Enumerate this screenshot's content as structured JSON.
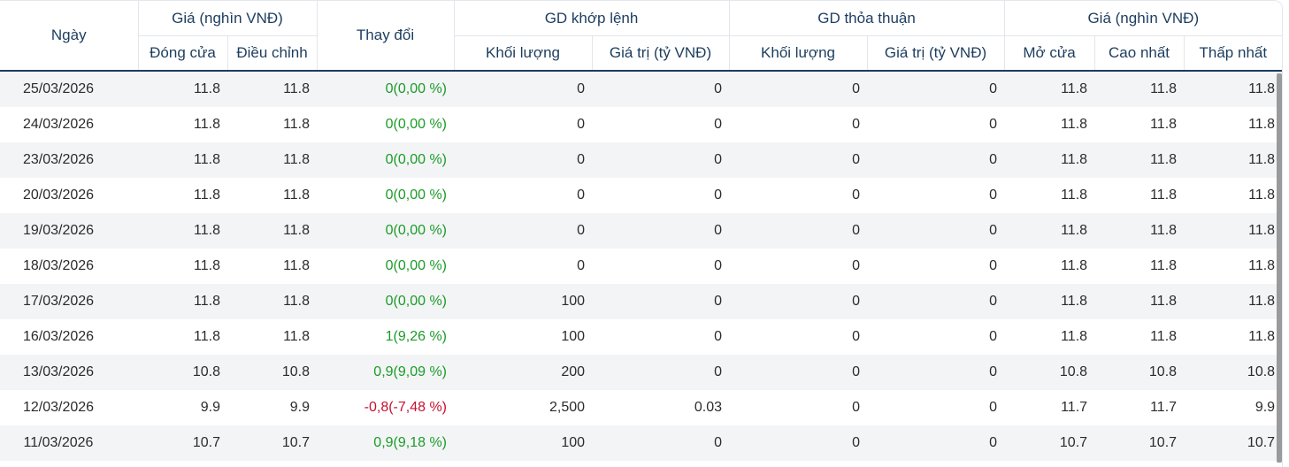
{
  "header": {
    "date": "Ngày",
    "price_group": "Giá (nghìn VNĐ)",
    "change": "Thay đổi",
    "matched_group": "GD khớp lệnh",
    "negotiated_group": "GD thỏa thuận",
    "price_group2": "Giá (nghìn VNĐ)",
    "close": "Đóng cửa",
    "adjusted": "Điều chỉnh",
    "matched_volume": "Khối lượng",
    "matched_value": "Giá trị (tỷ VNĐ)",
    "negotiated_volume": "Khối lượng",
    "negotiated_value": "Giá trị (tỷ VNĐ)",
    "open": "Mở cửa",
    "high": "Cao nhất",
    "low": "Thấp nhất"
  },
  "colors": {
    "up": "#1a9c28",
    "down": "#c8102e",
    "header_text": "#1c3d5e"
  },
  "rows": [
    {
      "date": "25/03/2026",
      "close": "11.8",
      "adjusted": "11.8",
      "change": "0(0,00 %)",
      "dir": "up",
      "mvol": "0",
      "mval": "0",
      "nvol": "0",
      "nval": "0",
      "open": "11.8",
      "high": "11.8",
      "low": "11.8"
    },
    {
      "date": "24/03/2026",
      "close": "11.8",
      "adjusted": "11.8",
      "change": "0(0,00 %)",
      "dir": "up",
      "mvol": "0",
      "mval": "0",
      "nvol": "0",
      "nval": "0",
      "open": "11.8",
      "high": "11.8",
      "low": "11.8"
    },
    {
      "date": "23/03/2026",
      "close": "11.8",
      "adjusted": "11.8",
      "change": "0(0,00 %)",
      "dir": "up",
      "mvol": "0",
      "mval": "0",
      "nvol": "0",
      "nval": "0",
      "open": "11.8",
      "high": "11.8",
      "low": "11.8"
    },
    {
      "date": "20/03/2026",
      "close": "11.8",
      "adjusted": "11.8",
      "change": "0(0,00 %)",
      "dir": "up",
      "mvol": "0",
      "mval": "0",
      "nvol": "0",
      "nval": "0",
      "open": "11.8",
      "high": "11.8",
      "low": "11.8"
    },
    {
      "date": "19/03/2026",
      "close": "11.8",
      "adjusted": "11.8",
      "change": "0(0,00 %)",
      "dir": "up",
      "mvol": "0",
      "mval": "0",
      "nvol": "0",
      "nval": "0",
      "open": "11.8",
      "high": "11.8",
      "low": "11.8"
    },
    {
      "date": "18/03/2026",
      "close": "11.8",
      "adjusted": "11.8",
      "change": "0(0,00 %)",
      "dir": "up",
      "mvol": "0",
      "mval": "0",
      "nvol": "0",
      "nval": "0",
      "open": "11.8",
      "high": "11.8",
      "low": "11.8"
    },
    {
      "date": "17/03/2026",
      "close": "11.8",
      "adjusted": "11.8",
      "change": "0(0,00 %)",
      "dir": "up",
      "mvol": "100",
      "mval": "0",
      "nvol": "0",
      "nval": "0",
      "open": "11.8",
      "high": "11.8",
      "low": "11.8"
    },
    {
      "date": "16/03/2026",
      "close": "11.8",
      "adjusted": "11.8",
      "change": "1(9,26 %)",
      "dir": "up",
      "mvol": "100",
      "mval": "0",
      "nvol": "0",
      "nval": "0",
      "open": "11.8",
      "high": "11.8",
      "low": "11.8"
    },
    {
      "date": "13/03/2026",
      "close": "10.8",
      "adjusted": "10.8",
      "change": "0,9(9,09 %)",
      "dir": "up",
      "mvol": "200",
      "mval": "0",
      "nvol": "0",
      "nval": "0",
      "open": "10.8",
      "high": "10.8",
      "low": "10.8"
    },
    {
      "date": "12/03/2026",
      "close": "9.9",
      "adjusted": "9.9",
      "change": "-0,8(-7,48 %)",
      "dir": "down",
      "mvol": "2,500",
      "mval": "0.03",
      "nvol": "0",
      "nval": "0",
      "open": "11.7",
      "high": "11.7",
      "low": "9.9"
    },
    {
      "date": "11/03/2026",
      "close": "10.7",
      "adjusted": "10.7",
      "change": "0,9(9,18 %)",
      "dir": "up",
      "mvol": "100",
      "mval": "0",
      "nvol": "0",
      "nval": "0",
      "open": "10.7",
      "high": "10.7",
      "low": "10.7"
    }
  ]
}
